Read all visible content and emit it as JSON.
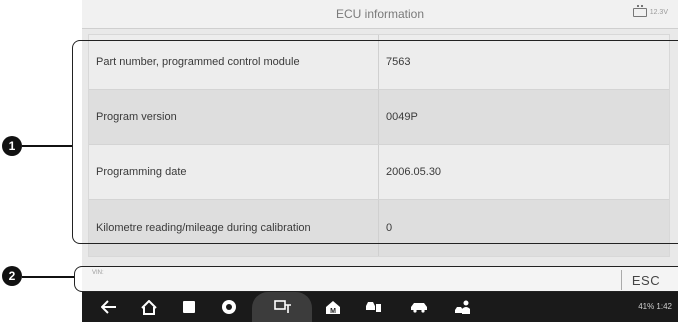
{
  "header": {
    "title": "ECU information",
    "battery_voltage": "12.3V"
  },
  "ecu_table": {
    "rows": [
      {
        "label": "Part number, programmed control module",
        "value": "7563"
      },
      {
        "label": "Program version",
        "value": "0049P"
      },
      {
        "label": "Programming date",
        "value": "2006.05.30"
      },
      {
        "label": "Kilometre reading/mileage during calibration",
        "value": "0"
      }
    ]
  },
  "footer": {
    "vin_label": "VIN:",
    "esc_label": "ESC"
  },
  "navbar": {
    "icons": [
      "back-icon",
      "home-icon",
      "recent-apps-icon",
      "chrome-icon",
      "vci-connect-icon",
      "maxifix-icon",
      "car-diagnostic-icon",
      "car-icon",
      "mechanic-icon"
    ],
    "status_text": "41% 1:42"
  },
  "callouts": {
    "one": "1",
    "two": "2"
  }
}
